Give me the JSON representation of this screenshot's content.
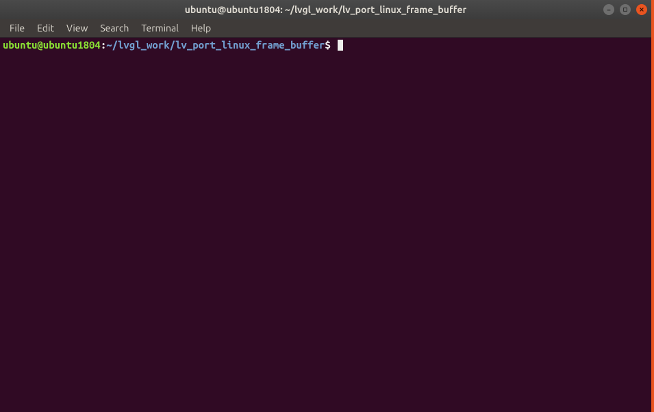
{
  "window": {
    "title": "ubuntu@ubuntu1804: ~/lvgl_work/lv_port_linux_frame_buffer"
  },
  "menu": {
    "items": [
      "File",
      "Edit",
      "View",
      "Search",
      "Terminal",
      "Help"
    ]
  },
  "prompt": {
    "user_host": "ubuntu@ubuntu1804",
    "separator": ":",
    "path": "~/lvgl_work/lv_port_linux_frame_buffer",
    "symbol": "$"
  }
}
